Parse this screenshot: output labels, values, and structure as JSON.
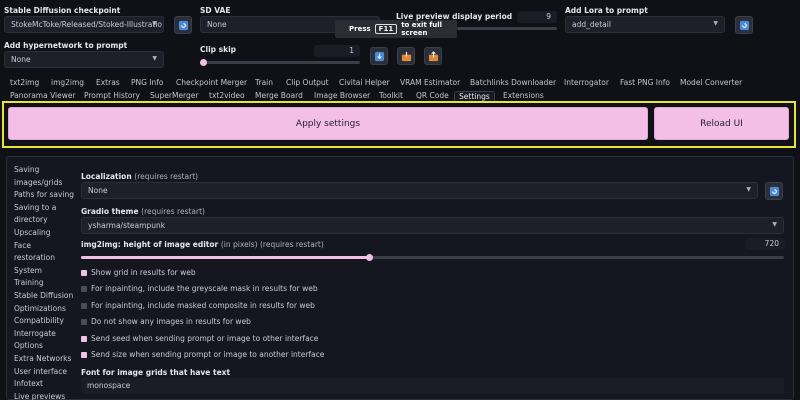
{
  "top": {
    "checkpoint_label": "Stable Diffusion checkpoint",
    "checkpoint_value": "StokeMcToke/Released/Stoked-Illustratio",
    "vae_label": "SD VAE",
    "vae_value": "None",
    "preview_label": "Live preview display period",
    "preview_value": "9",
    "lora_label": "Add Lora to prompt",
    "lora_value": "add_detail",
    "hypernet_label": "Add hypernetwork to prompt",
    "hypernet_value": "None",
    "clip_label": "Clip skip",
    "clip_value": "1",
    "clip_fraction": 0.0,
    "fullscreen_press": "Press",
    "fullscreen_key": "F11",
    "fullscreen_text": "to exit full screen"
  },
  "tabs_row1": [
    "txt2img",
    "img2img",
    "Extras",
    "PNG Info",
    "Checkpoint Merger",
    "Train",
    "Clip Output",
    "Civitai Helper",
    "VRAM Estimator",
    "Batchlinks Downloader",
    "Interrogator",
    "Fast PNG Info",
    "Model Converter"
  ],
  "tabs_row2": [
    "Panorama Viewer",
    "Prompt History",
    "SuperMerger",
    "txt2video",
    "Merge Board",
    "Image Browser",
    "Toolkit",
    "QR Code",
    "Settings",
    "Extensions"
  ],
  "actions": {
    "apply": "Apply settings",
    "reload": "Reload UI"
  },
  "sidebar": [
    "Saving",
    "images/grids",
    "Paths for saving",
    "Saving to a",
    "directory",
    "Upscaling",
    "Face",
    "restoration",
    "System",
    "Training",
    "Stable Diffusion",
    "Optimizations",
    "Compatibility",
    "Interrogate",
    "Options",
    "Extra Networks",
    "User interface",
    "Infotext",
    "Live previews"
  ],
  "settings": {
    "localization_label": "Localization",
    "localization_note": "(requires restart)",
    "localization_value": "None",
    "gradio_label": "Gradio theme",
    "gradio_note": "(requires restart)",
    "gradio_value": "ysharma/steampunk",
    "img2img_label": "img2img: height of image editor",
    "img2img_note": "(in pixels) (requires restart)",
    "img2img_value": "720",
    "img2img_fraction": 0.41,
    "checkboxes": [
      {
        "label": "Show grid in results for web",
        "checked": true
      },
      {
        "label": "For inpainting, include the greyscale mask in results for web",
        "checked": false
      },
      {
        "label": "For inpainting, include masked composite in results for web",
        "checked": false
      },
      {
        "label": "Do not show any images in results for web",
        "checked": false
      },
      {
        "label": "Send seed when sending prompt or image to other interface",
        "checked": true
      },
      {
        "label": "Send size when sending prompt or image to another interface",
        "checked": true
      }
    ],
    "font_label": "Font for image grids that have text",
    "font_value": "monospace"
  },
  "colors": {
    "accent": "#f4bfe6",
    "highlight": "#e8e33a"
  }
}
